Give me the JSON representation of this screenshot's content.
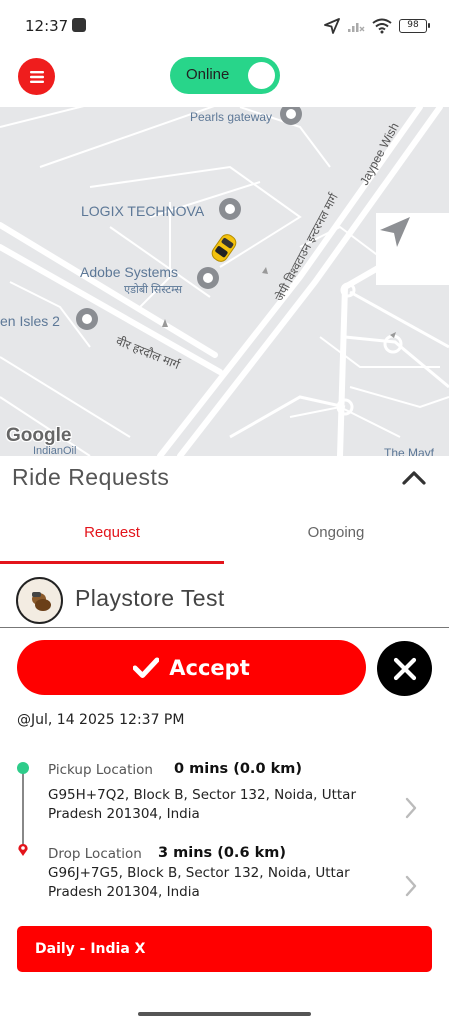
{
  "status_bar": {
    "time": "12:37",
    "battery": "98",
    "icons": [
      "app-notification-icon",
      "location-arrow-icon",
      "signal-off-icon",
      "wifi-icon",
      "battery-icon"
    ]
  },
  "header": {
    "menu_icon": "hamburger-icon",
    "online_label": "Online",
    "online": true,
    "accent_color": "#28d58a"
  },
  "map": {
    "labels": {
      "pearls": "Pearls gateway",
      "logix": "LOGIX TECHNOVA",
      "adobe": "Adobe Systems",
      "adobe_hindi": "एडोबी सिस्टम्स",
      "isles": "en Isles 2",
      "veer": "वीर हरदौल मार्ग",
      "jaypee": "जेपी विश्वटाउन इन्टरनल मार्ग",
      "jaypee_en": "Jaypee Wish",
      "indianoil": "IndianOil",
      "mayfair": "The Mayf",
      "google": "Google"
    },
    "recenter_icon": "navigation-arrow-icon",
    "car_icon": "taxi-car-icon"
  },
  "panel": {
    "title": "Ride Requests",
    "collapse_icon": "chevron-up-icon",
    "tabs": [
      {
        "label": "Request",
        "active": true
      },
      {
        "label": "Ongoing",
        "active": false
      }
    ],
    "brand_color": "#ff0000"
  },
  "request": {
    "rider_name": "Playstore Test",
    "accept_label": "Accept",
    "time": "@Jul, 14 2025 12:37 PM",
    "pickup": {
      "label": "Pickup Location",
      "eta": "0 mins (0.0 km)",
      "address": "G95H+7Q2, Block B, Sector 132, Noida, Uttar Pradesh 201304, India"
    },
    "drop": {
      "label": "Drop Location",
      "eta": "3 mins (0.6 km)",
      "address": "G96J+7G5, Block B, Sector 132, Noida, Uttar Pradesh 201304, India"
    },
    "ride_type": "Daily - India X"
  }
}
